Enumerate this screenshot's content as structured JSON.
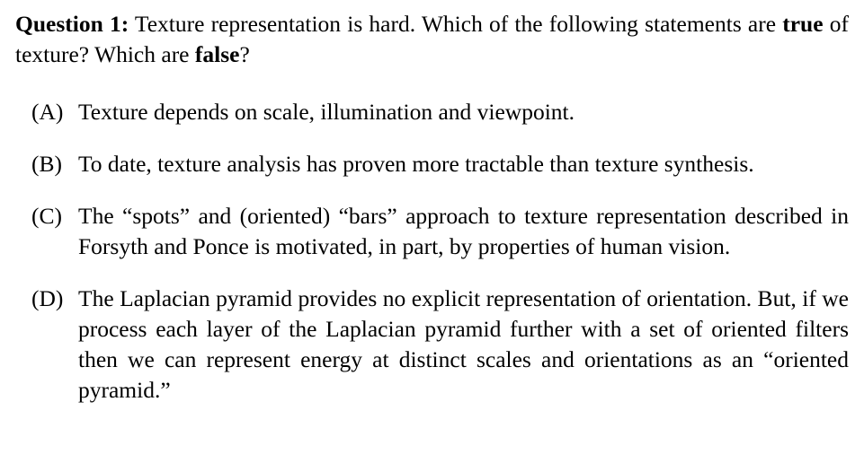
{
  "question": {
    "label": "Question 1:",
    "text_before": " Texture representation is hard.  Which of the following statements are ",
    "true_word": "true",
    "text_middle": " of texture? Which are ",
    "false_word": "false",
    "text_after": "?"
  },
  "options": [
    {
      "label": "(A)",
      "text": "Texture depends on scale, illumination and viewpoint."
    },
    {
      "label": "(B)",
      "text": "To date, texture analysis has proven more tractable than texture synthesis."
    },
    {
      "label": "(C)",
      "text": "The “spots” and (oriented) “bars” approach to texture representation de­scribed in Forsyth and Ponce is motivated, in part, by properties of human vision."
    },
    {
      "label": "(D)",
      "text": "The Laplacian pyramid provides no explicit representation of orientation. But, if we process each layer of the Laplacian pyramid further with a set of oriented filters then we can represent energy at distinct scales and orienta­tions as an “oriented pyramid.”"
    }
  ]
}
